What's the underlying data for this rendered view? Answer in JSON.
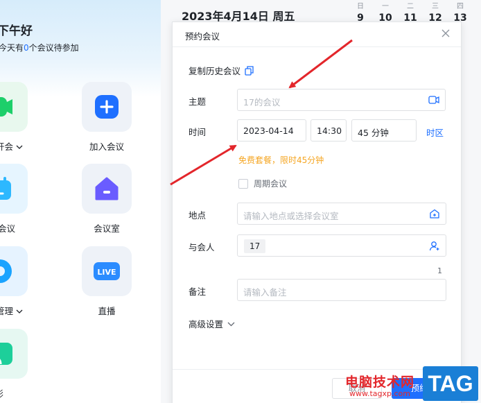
{
  "left_panel": {
    "greeting": "下午好",
    "subtitle_prefix": "今天有",
    "subtitle_count": "0",
    "subtitle_suffix": "个会议待参加",
    "tiles": [
      {
        "label": "开会",
        "icon": "video-camera-icon",
        "color": "#1dcf6a"
      },
      {
        "label": "加入会议",
        "icon": "plus-icon",
        "color": "#1e6fff"
      },
      {
        "label": "预约会议",
        "icon": "calendar-icon",
        "color": "#2db8ff"
      },
      {
        "label": "会议室",
        "icon": "house-icon",
        "color": "#6a5cff"
      },
      {
        "label": "管理",
        "icon": "record-icon",
        "color": "#1aa3ff"
      },
      {
        "label": "直播",
        "icon": "live-icon",
        "color": "#2b8cff"
      },
      {
        "label": "投影",
        "icon": "screen-cast-icon",
        "color": "#1dcf9a"
      }
    ]
  },
  "calendar": {
    "date_title": "2023年4月14日 周五",
    "weekdays": [
      "日",
      "一",
      "二",
      "三",
      "四"
    ],
    "days": [
      "9",
      "10",
      "11",
      "12",
      "13"
    ]
  },
  "dialog": {
    "title": "预约会议",
    "copy_history": "复制历史会议",
    "topic_label": "主题",
    "topic_placeholder": "17的会议",
    "time_label": "时间",
    "date_value": "2023-04-14",
    "time_value": "14:30",
    "duration_value": "45 分钟",
    "timezone_link": "时区",
    "free_plan_notice": "免费套餐，限时45分钟",
    "recurring_label": "周期会议",
    "location_label": "地点",
    "location_placeholder": "请输入地点或选择会议室",
    "attendees_label": "与会人",
    "attendee_chip": "17",
    "attendee_count": "1",
    "notes_label": "备注",
    "notes_placeholder": "请输入备注",
    "advanced_settings": "高级设置",
    "cancel_button": "取消",
    "confirm_button": "预约"
  },
  "watermark": {
    "site_name": "电脑技术网",
    "site_url": "www.tagxp.com",
    "badge": "TAG"
  },
  "colors": {
    "accent": "#1e6fff",
    "warning": "#f5a623",
    "annotation_arrow": "#e3262b"
  }
}
